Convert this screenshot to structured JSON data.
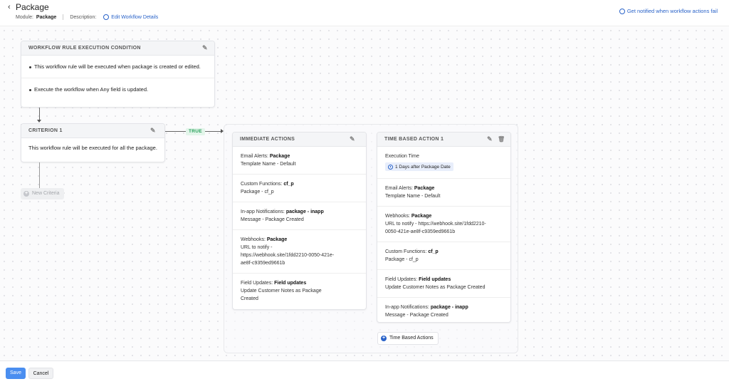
{
  "header": {
    "title": "Package",
    "module_label": "Module:",
    "module_value": "Package",
    "description_label": "Description:",
    "edit_link": "Edit Workflow Details",
    "notify_link": "Get notified when workflow actions fail"
  },
  "condition_card": {
    "title": "WORKFLOW RULE EXECUTION CONDITION",
    "items": [
      "This workflow rule will be executed when package is created or edited.",
      "Execute the workflow when Any field is updated."
    ]
  },
  "criterion_card": {
    "title": "CRITERION 1",
    "text": "This workflow rule will be executed for all the package."
  },
  "true_label": "TRUE",
  "new_criteria": "New Criteria",
  "immediate_actions": {
    "title": "IMMEDIATE ACTIONS",
    "sections": [
      {
        "label": "Email Alerts:",
        "value": "Package",
        "lines": [
          "Template Name - Default"
        ]
      },
      {
        "label": "Custom Functions:",
        "value": "cf_p",
        "lines": [
          "Package - cf_p"
        ]
      },
      {
        "label": "In-app Notifications:",
        "value": "package - inapp",
        "lines": [
          "Message - Package Created"
        ]
      },
      {
        "label": "Webhooks:",
        "value": "Package",
        "lines": [
          "URL to notify -",
          "https://webhook.site/1fdd2210-0050-421e-",
          "ae8f-c9359ed9661b"
        ]
      },
      {
        "label": "Field Updates:",
        "value": "Field updates",
        "lines": [
          "Update Customer Notes as Package",
          "Created"
        ]
      }
    ]
  },
  "time_based_action": {
    "title": "TIME BASED ACTION 1",
    "execution_label": "Execution Time",
    "execution_value": "1 Days after Package Date",
    "sections": [
      {
        "label": "Email Alerts:",
        "value": "Package",
        "lines": [
          "Template Name - Default"
        ]
      },
      {
        "label": "Webhooks:",
        "value": "Package",
        "lines": [
          "URL to notify - https://webhook.site/1fdd2210-",
          "0050-421e-ae8f-c9359ed9661b"
        ]
      },
      {
        "label": "Custom Functions:",
        "value": "cf_p",
        "lines": [
          "Package - cf_p"
        ]
      },
      {
        "label": "Field Updates:",
        "value": "Field updates",
        "lines": [
          "Update Customer Notes as Package Created"
        ]
      },
      {
        "label": "In-app Notifications:",
        "value": "package - inapp",
        "lines": [
          "Message - Package Created"
        ]
      }
    ]
  },
  "time_based_button": "Time Based Actions",
  "footer": {
    "save": "Save",
    "cancel": "Cancel"
  },
  "colors": {
    "accent": "#2a63c9",
    "save_bg": "#4a8ef0",
    "true_green": "#27a05a"
  }
}
